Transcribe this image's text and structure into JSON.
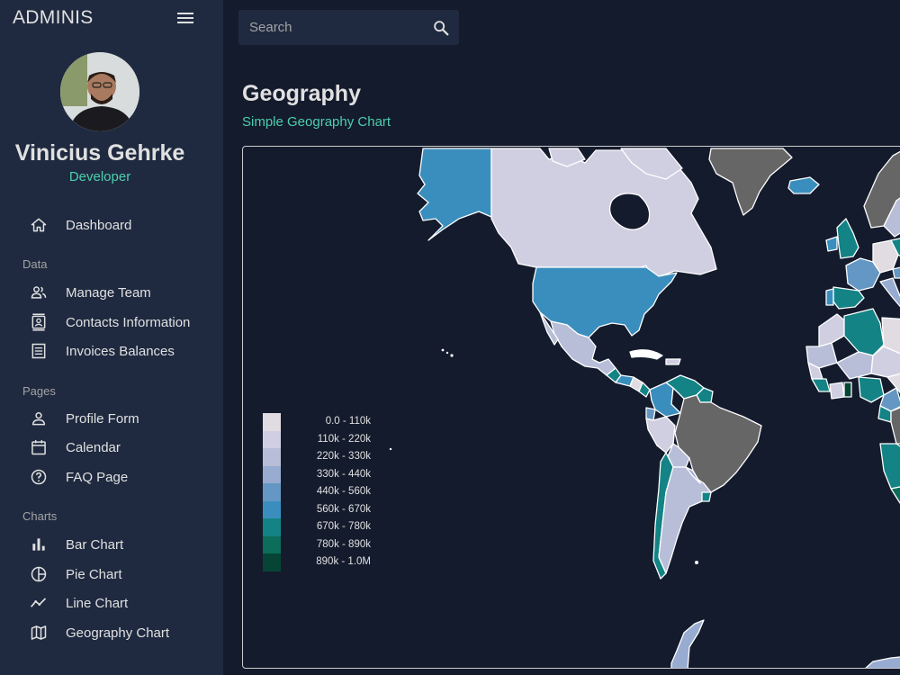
{
  "app": {
    "brand": "ADMINIS"
  },
  "profile": {
    "name": "Vinicius Gehrke",
    "role": "Developer"
  },
  "sidebar": {
    "dashboard": "Dashboard",
    "sections": {
      "data": "Data",
      "pages": "Pages",
      "charts": "Charts"
    },
    "items": {
      "manage_team": "Manage Team",
      "contacts": "Contacts Information",
      "invoices": "Invoices Balances",
      "profile_form": "Profile Form",
      "calendar": "Calendar",
      "faq": "FAQ Page",
      "bar_chart": "Bar Chart",
      "pie_chart": "Pie Chart",
      "line_chart": "Line Chart",
      "geography_chart": "Geography Chart"
    },
    "icons": {
      "menu": "hamburger-menu-icon",
      "dashboard": "home-icon",
      "manage_team": "people-icon",
      "contacts": "contact-card-icon",
      "invoices": "receipt-icon",
      "profile_form": "person-icon",
      "calendar": "calendar-icon",
      "faq": "help-circle-icon",
      "bar_chart": "bar-chart-icon",
      "pie_chart": "pie-chart-icon",
      "line_chart": "timeline-icon",
      "geography_chart": "map-icon"
    }
  },
  "search": {
    "placeholder": "Search",
    "icon": "search-icon"
  },
  "header": {
    "title": "Geography",
    "subtitle": "Simple Geography Chart"
  },
  "colors": {
    "background": "#141b2d",
    "sidebar": "#1f2a40",
    "accent_green": "#4cceac",
    "no_data_gray": "#666666"
  },
  "chart_data": {
    "type": "choropleth",
    "legend": [
      {
        "label": "0.0 - 110k",
        "color": "#e0dce2"
      },
      {
        "label": "110k - 220k",
        "color": "#d0cfe2"
      },
      {
        "label": "220k - 330k",
        "color": "#b8bed8"
      },
      {
        "label": "330k - 440k",
        "color": "#97acd0"
      },
      {
        "label": "440k - 560k",
        "color": "#6497c3"
      },
      {
        "label": "560k - 670k",
        "color": "#3a8ebd"
      },
      {
        "label": "670k - 780k",
        "color": "#138385"
      },
      {
        "label": "780k - 890k",
        "color": "#0b6d5a"
      },
      {
        "label": "890k - 1.0M",
        "color": "#064535"
      }
    ]
  }
}
